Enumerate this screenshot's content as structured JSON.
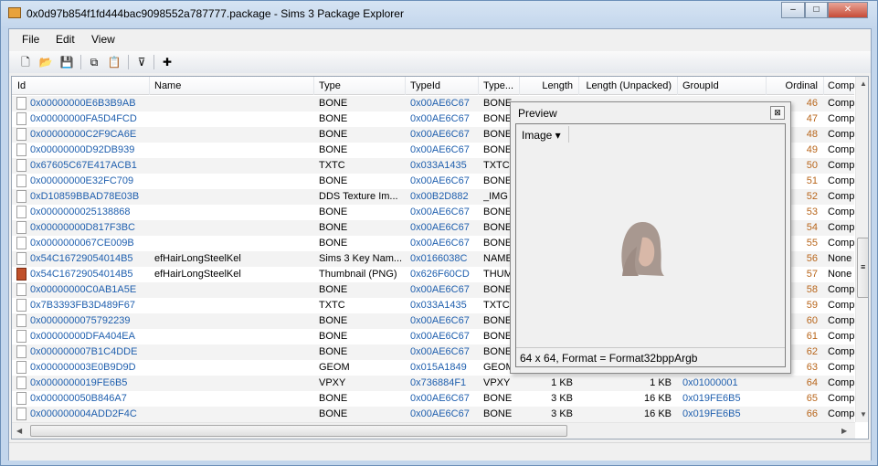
{
  "window": {
    "title": "0x0d97b854f1fd444bac9098552a787777.package - Sims 3 Package Explorer",
    "min": "–",
    "max": "□",
    "close": "✕"
  },
  "menu": [
    "File",
    "Edit",
    "View"
  ],
  "toolbar": {
    "icons": [
      "new-file-icon",
      "open-folder-icon",
      "save-icon",
      "copy-icon",
      "paste-icon",
      "filter-icon",
      "add-icon"
    ],
    "glyphs": [
      "🗋",
      "📂",
      "💾",
      "⧉",
      "📋",
      "⊽",
      "✚"
    ]
  },
  "columns": [
    "Id",
    "Name",
    "Type",
    "TypeId",
    "Type...",
    "Length",
    "Length (Unpacked)",
    "GroupId",
    "Ordinal",
    "Compr"
  ],
  "rows": [
    {
      "icon": "file",
      "id": "0x00000000E6B3B9AB",
      "name": "",
      "type": "BONE",
      "typeid": "0x00AE6C67",
      "tag": "BONE",
      "len": "",
      "ulen": "",
      "group": "",
      "ord": "46",
      "comp": "Compr"
    },
    {
      "icon": "file",
      "id": "0x00000000FA5D4FCD",
      "name": "",
      "type": "BONE",
      "typeid": "0x00AE6C67",
      "tag": "BONE",
      "len": "",
      "ulen": "",
      "group": "",
      "ord": "47",
      "comp": "Compr"
    },
    {
      "icon": "file",
      "id": "0x00000000C2F9CA6E",
      "name": "",
      "type": "BONE",
      "typeid": "0x00AE6C67",
      "tag": "BONE",
      "len": "",
      "ulen": "",
      "group": "",
      "ord": "48",
      "comp": "Compr"
    },
    {
      "icon": "file",
      "id": "0x00000000D92DB939",
      "name": "",
      "type": "BONE",
      "typeid": "0x00AE6C67",
      "tag": "BONE",
      "len": "",
      "ulen": "",
      "group": "",
      "ord": "49",
      "comp": "Compr"
    },
    {
      "icon": "file",
      "id": "0x67605C67E417ACB1",
      "name": "",
      "type": "TXTC",
      "typeid": "0x033A1435",
      "tag": "TXTC",
      "len": "",
      "ulen": "",
      "group": "",
      "ord": "50",
      "comp": "Compr"
    },
    {
      "icon": "file",
      "id": "0x00000000E32FC709",
      "name": "",
      "type": "BONE",
      "typeid": "0x00AE6C67",
      "tag": "BONE",
      "len": "",
      "ulen": "",
      "group": "",
      "ord": "51",
      "comp": "Compr"
    },
    {
      "icon": "file",
      "id": "0xD10859BBAD78E03B",
      "name": "",
      "type": "DDS Texture Im...",
      "typeid": "0x00B2D882",
      "tag": "_IMG",
      "len": "",
      "ulen": "",
      "group": "",
      "ord": "52",
      "comp": "Compr"
    },
    {
      "icon": "file",
      "id": "0x0000000025138868",
      "name": "",
      "type": "BONE",
      "typeid": "0x00AE6C67",
      "tag": "BONE",
      "len": "",
      "ulen": "",
      "group": "",
      "ord": "53",
      "comp": "Compr"
    },
    {
      "icon": "file",
      "id": "0x00000000D817F3BC",
      "name": "",
      "type": "BONE",
      "typeid": "0x00AE6C67",
      "tag": "BONE",
      "len": "",
      "ulen": "",
      "group": "",
      "ord": "54",
      "comp": "Compr"
    },
    {
      "icon": "file",
      "id": "0x0000000067CE009B",
      "name": "",
      "type": "BONE",
      "typeid": "0x00AE6C67",
      "tag": "BONE",
      "len": "",
      "ulen": "",
      "group": "",
      "ord": "55",
      "comp": "Compr"
    },
    {
      "icon": "file",
      "id": "0x54C16729054014B5",
      "name": "efHairLongSteelKel",
      "type": "Sims 3 Key Nam...",
      "typeid": "0x0166038C",
      "tag": "NAME",
      "len": "",
      "ulen": "",
      "group": "",
      "ord": "56",
      "comp": "None"
    },
    {
      "icon": "img",
      "id": "0x54C16729054014B5",
      "name": "efHairLongSteelKel",
      "type": "Thumbnail (PNG)",
      "typeid": "0x626F60CD",
      "tag": "THUM",
      "len": "",
      "ulen": "",
      "group": "",
      "ord": "57",
      "comp": "None"
    },
    {
      "icon": "file",
      "id": "0x00000000C0AB1A5E",
      "name": "",
      "type": "BONE",
      "typeid": "0x00AE6C67",
      "tag": "BONE",
      "len": "",
      "ulen": "",
      "group": "",
      "ord": "58",
      "comp": "Compr"
    },
    {
      "icon": "file",
      "id": "0x7B3393FB3D489F67",
      "name": "",
      "type": "TXTC",
      "typeid": "0x033A1435",
      "tag": "TXTC",
      "len": "",
      "ulen": "",
      "group": "",
      "ord": "59",
      "comp": "Compr"
    },
    {
      "icon": "file",
      "id": "0x0000000075792239",
      "name": "",
      "type": "BONE",
      "typeid": "0x00AE6C67",
      "tag": "BONE",
      "len": "",
      "ulen": "",
      "group": "",
      "ord": "60",
      "comp": "Compr"
    },
    {
      "icon": "file",
      "id": "0x00000000DFA404EA",
      "name": "",
      "type": "BONE",
      "typeid": "0x00AE6C67",
      "tag": "BONE",
      "len": "",
      "ulen": "",
      "group": "",
      "ord": "61",
      "comp": "Compr"
    },
    {
      "icon": "file",
      "id": "0x000000007B1C4DDE",
      "name": "",
      "type": "BONE",
      "typeid": "0x00AE6C67",
      "tag": "BONE",
      "len": "",
      "ulen": "",
      "group": "",
      "ord": "62",
      "comp": "Compr"
    },
    {
      "icon": "file",
      "id": "0x000000003E0B9D9D",
      "name": "",
      "type": "GEOM",
      "typeid": "0x015A1849",
      "tag": "GEOM",
      "len": "",
      "ulen": "",
      "group": "",
      "ord": "63",
      "comp": "Compr"
    },
    {
      "icon": "file",
      "id": "0x0000000019FE6B5",
      "name": "",
      "type": "VPXY",
      "typeid": "0x736884F1",
      "tag": "VPXY",
      "len": "1 KB",
      "ulen": "1 KB",
      "group": "0x01000001",
      "ord": "64",
      "comp": "Compr"
    },
    {
      "icon": "file",
      "id": "0x000000050B846A7",
      "name": "",
      "type": "BONE",
      "typeid": "0x00AE6C67",
      "tag": "BONE",
      "len": "3 KB",
      "ulen": "16 KB",
      "group": "0x019FE6B5",
      "ord": "65",
      "comp": "Compr"
    },
    {
      "icon": "file",
      "id": "0x000000004ADD2F4C",
      "name": "",
      "type": "BONE",
      "typeid": "0x00AE6C67",
      "tag": "BONE",
      "len": "3 KB",
      "ulen": "16 KB",
      "group": "0x019FE6B5",
      "ord": "66",
      "comp": "Compr"
    }
  ],
  "preview": {
    "title": "Preview",
    "close": "⊠",
    "mode": "Image ▾",
    "status": "64 x 64, Format = Format32bppArgb"
  },
  "scroll": {
    "grip": "≡",
    "up": "▲",
    "down": "▼",
    "left": "◀",
    "right": "▶"
  }
}
